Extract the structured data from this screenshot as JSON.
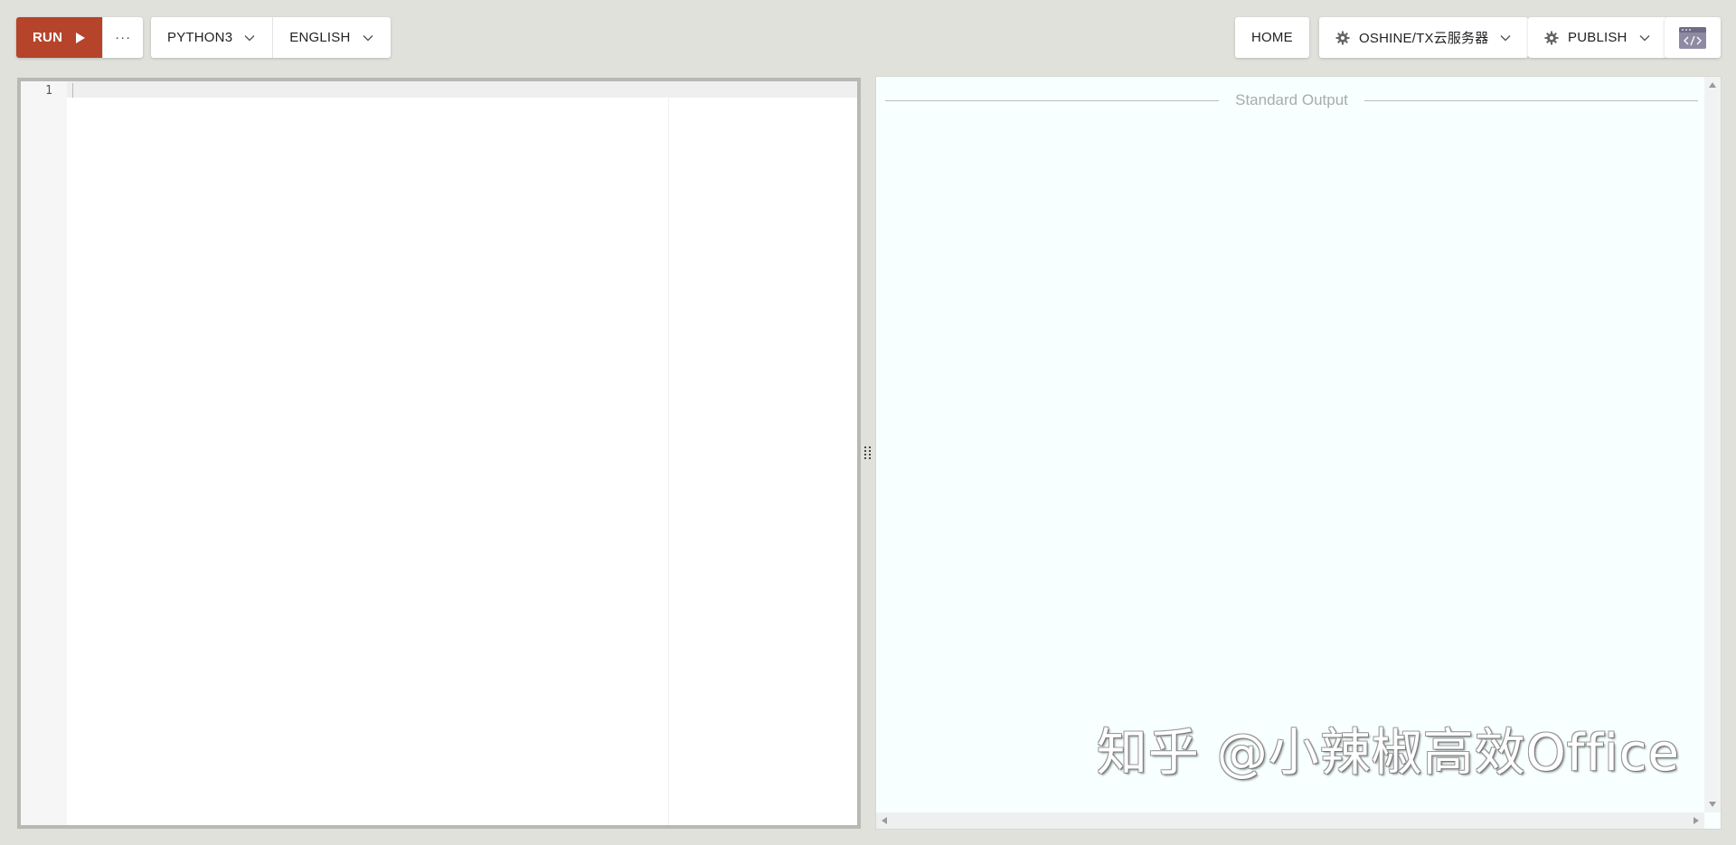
{
  "toolbar": {
    "run_label": "RUN",
    "more_label": "···",
    "language": "PYTHON3",
    "locale": "ENGLISH",
    "home_label": "HOME",
    "server_label": "OSHINE/TX云服务器",
    "publish_label": "PUBLISH"
  },
  "editor": {
    "line_numbers": [
      "1"
    ],
    "content": ""
  },
  "output": {
    "header": "Standard Output"
  },
  "watermark": "知乎 @小辣椒高效Office",
  "colors": {
    "run_button": "#b5442a",
    "page_background": "#e1e1dc",
    "output_background": "#f7ffff"
  },
  "icons": {
    "run": "play-icon",
    "more": "more-dots-icon",
    "dropdown": "chevron-down-icon",
    "settings": "gear-icon",
    "embed": "code-embed-icon",
    "splitter": "grip-icon"
  }
}
